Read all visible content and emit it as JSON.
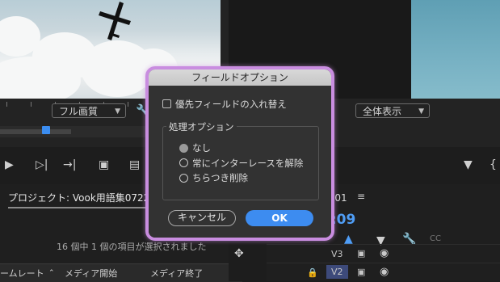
{
  "source_monitor": {
    "quality_dropdown": "フル画質"
  },
  "program_monitor": {
    "zoom_dropdown": "全体表示"
  },
  "project_panel": {
    "tab_label": "プロジェクト: Vook用語集0722_1",
    "status": "16 個中 1 個の項目が選択されました",
    "columns": [
      "ームレート",
      "メディア開始",
      "メディア終了"
    ]
  },
  "timeline": {
    "sequence_tab": "-01",
    "timecode": "3:09",
    "tracks": [
      "V3",
      "V2"
    ]
  },
  "dialog": {
    "title": "フィールドオプション",
    "swap_fields_label": "優先フィールドの入れ替え",
    "swap_fields_checked": false,
    "processing_group_title": "処理オプション",
    "options": [
      "なし",
      "常にインターレースを解除",
      "ちらつき削除"
    ],
    "selected_option": "なし",
    "cancel_label": "キャンセル",
    "ok_label": "OK"
  },
  "colors": {
    "accent": "#3d8cf0",
    "highlight_ring": "#c98de0",
    "timecode": "#4f9df5"
  }
}
